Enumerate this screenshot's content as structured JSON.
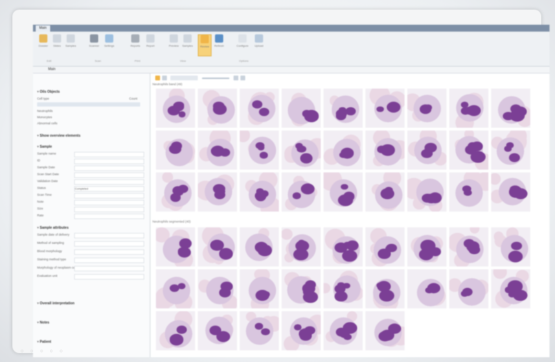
{
  "ribbon_tab": "Main",
  "subbar_title": "Main",
  "ribbon": {
    "buttons": [
      {
        "label": "Dossier",
        "icon": "folder-icon",
        "color": "#e7b85a"
      },
      {
        "label": "Slides",
        "icon": "slides-icon",
        "color": "#cfd6de"
      },
      {
        "label": "Samples",
        "icon": "samples-icon",
        "color": "#cfd6de"
      },
      {
        "label": "Scanner",
        "icon": "microscope-icon",
        "color": "#8a94a2"
      },
      {
        "label": "Settings",
        "icon": "settings-icon",
        "color": "#9cbfe0"
      },
      {
        "label": "Reports",
        "icon": "printer-icon",
        "color": "#a6adb6"
      },
      {
        "label": "Report",
        "icon": "document-icon",
        "color": "#cfd6de"
      },
      {
        "label": "Preview",
        "icon": "preview-icon",
        "color": "#cfd6de"
      },
      {
        "label": "Samples",
        "icon": "grid-icon",
        "color": "#cfd6de"
      },
      {
        "label": "Review",
        "icon": "review-icon",
        "color": "#f0b548"
      },
      {
        "label": "Refresh",
        "icon": "refresh-icon",
        "color": "#5a8fc7"
      },
      {
        "label": "Configure",
        "icon": "configure-icon",
        "color": "#dde2e8"
      },
      {
        "label": "Upload",
        "icon": "cloud-icon",
        "color": "#b7c9dc"
      }
    ],
    "groups": [
      "Edit",
      "Scan",
      "Print",
      "View",
      "Options"
    ]
  },
  "left_panel": {
    "sections": {
      "objects": "Oils Objects",
      "cell_type": "Cell type",
      "count": "Count",
      "cell_rows": [
        "Neutrophils",
        "Monocytes",
        "Abnormal cells"
      ],
      "show_elements": "Show overview elements",
      "sample": "Sample",
      "sample_fields": [
        "Sample name",
        "ID",
        "Sample Date",
        "Scan Start Date",
        "Validation Date",
        "Status",
        "Scan Time",
        "Note",
        "Size",
        "Rate"
      ],
      "attributes": "Sample attributes",
      "attribute_fields": [
        "Sample date of delivery",
        "Method of sampling",
        "Blood morphology",
        "Staining method type",
        "Morphology of neoplasm cells",
        "Evaluation unit"
      ],
      "interpretation": "Overall interpretation",
      "notes": "Notes",
      "patient": "Patient"
    },
    "status_value": "Completed"
  },
  "gallery": {
    "section1": "Neutrophils band (49)",
    "section2": "Neutrophils segmented (40)"
  },
  "status_icons": "○ ○ ○ ○ ○",
  "cell_colors": {
    "bg": "#d9c6df",
    "nuc": "#7b3f95",
    "rbc": "#ead8e4"
  }
}
